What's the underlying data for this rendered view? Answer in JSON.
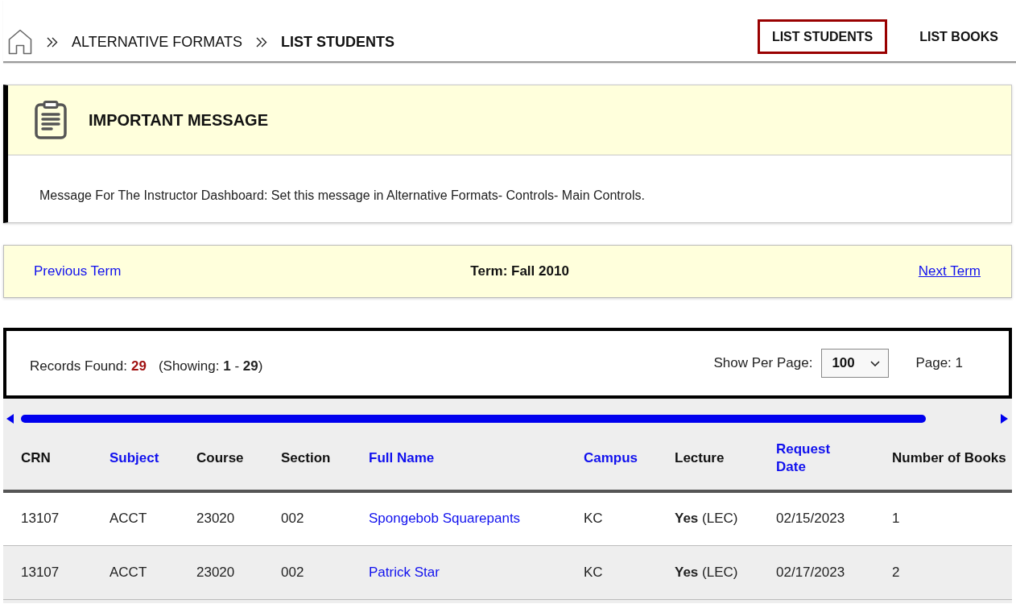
{
  "breadcrumb": [
    {
      "label": "ALTERNATIVE FORMATS",
      "current": false
    },
    {
      "label": "LIST STUDENTS",
      "current": true
    }
  ],
  "nav": [
    {
      "label": "LIST STUDENTS",
      "selected": true
    },
    {
      "label": "LIST BOOKS",
      "selected": false
    }
  ],
  "message": {
    "title": "IMPORTANT MESSAGE",
    "text": "Message For The Instructor Dashboard: Set this message in Alternative Formats- Controls- Main Controls."
  },
  "term_bar": {
    "previous": {
      "label": "Previous Term",
      "hovered": false
    },
    "term": "Term: Fall 2010",
    "next": {
      "label": "Next Term",
      "hovered": true
    }
  },
  "records": {
    "label": "Records Found:",
    "count": "29",
    "showing": "(Showing: **1** - **29**)",
    "per_page_label": "Show Per Page:",
    "per_page": "100",
    "page": "Page: 1"
  },
  "table": {
    "columns": [
      {
        "label": "CRN",
        "sortable": false
      },
      {
        "label": "Subject",
        "sortable": true
      },
      {
        "label": "Course",
        "sortable": false
      },
      {
        "label": "Section",
        "sortable": false
      },
      {
        "label": "Full Name",
        "sortable": true
      },
      {
        "label": "Campus",
        "sortable": true
      },
      {
        "label": "Lecture",
        "sortable": false
      },
      {
        "label": "Request Date",
        "sortable": true
      },
      {
        "label": "Number of Books",
        "sortable": false
      }
    ],
    "rows": [
      {
        "crn": "13107",
        "subject": "ACCT",
        "course": "23020",
        "section": "002",
        "full_name": "Spongebob Squarepants",
        "campus": "KC",
        "lecture": "**Yes** (LEC)",
        "request_date": "02/15/2023",
        "number_of_books": "1"
      },
      {
        "crn": "13107",
        "subject": "ACCT",
        "course": "23020",
        "section": "002",
        "full_name": "Patrick Star",
        "campus": "KC",
        "lecture": "**Yes** (LEC)",
        "request_date": "02/17/2023",
        "number_of_books": "2"
      }
    ]
  }
}
